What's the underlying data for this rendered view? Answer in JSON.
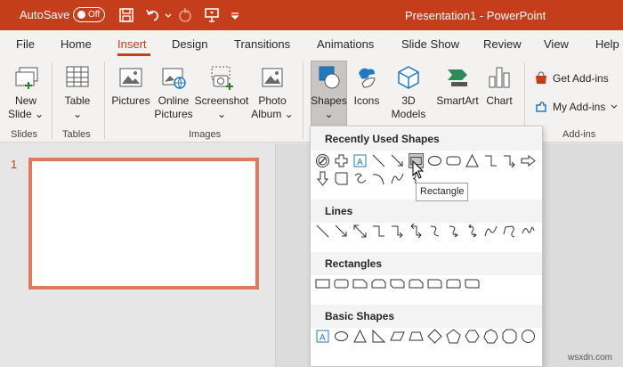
{
  "titlebar": {
    "autosave": "AutoSave",
    "toggle_state": "Off",
    "title": "Presentation1  -  PowerPoint",
    "bg": "#c43e1c"
  },
  "tabs": [
    "File",
    "Home",
    "Insert",
    "Design",
    "Transitions",
    "Animations",
    "Slide Show",
    "Review",
    "View",
    "Help"
  ],
  "active_tab": "Insert",
  "ribbon": {
    "new_slide": [
      "New",
      "Slide ⌄"
    ],
    "table": [
      "Table",
      "⌄"
    ],
    "pictures": "Pictures",
    "online_pictures": [
      "Online",
      "Pictures"
    ],
    "screenshot": [
      "Screenshot",
      "⌄"
    ],
    "photo_album": [
      "Photo",
      "Album ⌄"
    ],
    "shapes": [
      "Shapes",
      "⌄"
    ],
    "icons": "Icons",
    "models": [
      "3D",
      "Models ⌄"
    ],
    "smartart": "SmartArt",
    "chart": "Chart",
    "get_addins": "Get Add-ins",
    "my_addins": "My Add-ins",
    "groups": {
      "slides": "Slides",
      "tables": "Tables",
      "images": "Images",
      "addins": "Add-ins"
    }
  },
  "slide_pane": {
    "slide_number": "1"
  },
  "shapes_dropdown": {
    "sections": [
      "Recently Used Shapes",
      "Lines",
      "Rectangles",
      "Basic Shapes"
    ],
    "tooltip": "Rectangle",
    "basic_text_glyph": "A",
    "recent_text_glyph": "A"
  },
  "watermark": "wsxdn.com"
}
